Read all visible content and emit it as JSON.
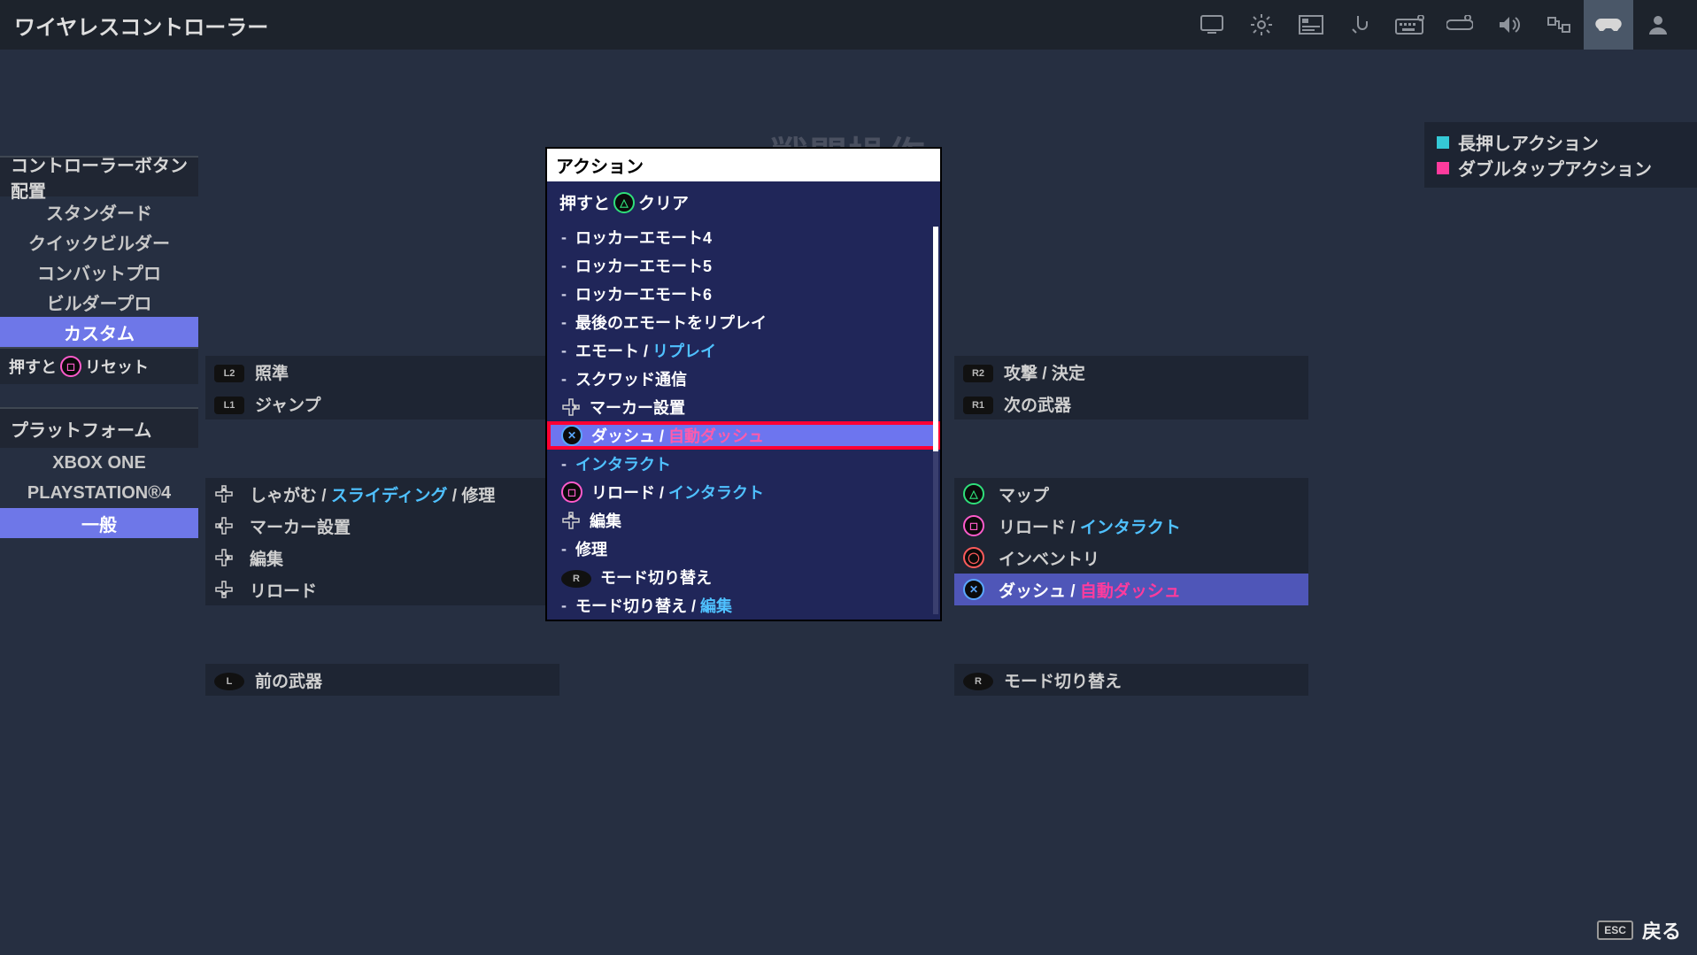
{
  "window": {
    "title": "ワイヤレスコントローラー"
  },
  "page": {
    "title": "戦闘操作"
  },
  "legend": {
    "hold": {
      "color": "#35c9d6",
      "label": "長押しアクション"
    },
    "double": {
      "color": "#ff3b9d",
      "label": "ダブルタップアクション"
    }
  },
  "sidebar": {
    "layout_header": "コントローラーボタン配置",
    "layouts": [
      {
        "label": "スタンダード"
      },
      {
        "label": "クイックビルダー"
      },
      {
        "label": "コンバットプロ"
      },
      {
        "label": "ビルダープロ"
      },
      {
        "label": "カスタム",
        "selected": true
      }
    ],
    "reset": {
      "prefix": "押すと",
      "suffix": "リセット"
    },
    "platform_header": "プラットフォーム",
    "platforms": [
      {
        "label": "XBOX ONE"
      },
      {
        "label": "PLAYSTATION®4"
      },
      {
        "label": "一般",
        "selected": true
      }
    ]
  },
  "bindings": {
    "left": [
      {
        "icon": "l2",
        "labels": [
          "照準"
        ]
      },
      {
        "icon": "l1",
        "labels": [
          "ジャンプ"
        ],
        "gapAfter": true
      },
      {
        "icon": "dpad-u",
        "labels": [
          "しゃがむ",
          " / ",
          {
            "t": "スライディング",
            "hl": true
          },
          " / ",
          "修理"
        ]
      },
      {
        "icon": "dpad-l",
        "labels": [
          "マーカー設置"
        ]
      },
      {
        "icon": "dpad-r",
        "labels": [
          "編集"
        ]
      },
      {
        "icon": "dpad-d",
        "labels": [
          "リロード"
        ],
        "gapAfter": true
      },
      {
        "icon": "ls",
        "labels": [
          "前の武器"
        ]
      }
    ],
    "right": [
      {
        "icon": "r2",
        "labels": [
          "攻撃 / 決定"
        ]
      },
      {
        "icon": "r1",
        "labels": [
          "次の武器"
        ],
        "gapAfter": true
      },
      {
        "icon": "ps-t",
        "labels": [
          "マップ"
        ]
      },
      {
        "icon": "ps-s",
        "labels": [
          "リロード / ",
          {
            "t": "インタラクト",
            "hl": true
          }
        ]
      },
      {
        "icon": "ps-o",
        "labels": [
          "インベントリ"
        ]
      },
      {
        "icon": "ps-x",
        "labels": [
          "ダッシュ / ",
          {
            "t": "自動ダッシュ",
            "dt": true
          }
        ],
        "selected": true,
        "gapAfter": true
      },
      {
        "icon": "rs",
        "labels": [
          "モード切り替え"
        ]
      }
    ]
  },
  "popup": {
    "title": "アクション",
    "subheader": {
      "prefix": "押すと",
      "suffix": "クリア"
    },
    "items": [
      {
        "icon": "-",
        "labels": [
          "ロッカーエモート4"
        ]
      },
      {
        "icon": "-",
        "labels": [
          "ロッカーエモート5"
        ]
      },
      {
        "icon": "-",
        "labels": [
          "ロッカーエモート6"
        ]
      },
      {
        "icon": "-",
        "labels": [
          "最後のエモートをリプレイ"
        ]
      },
      {
        "icon": "-",
        "labels": [
          "エモート / ",
          {
            "t": "リプレイ",
            "hl": true
          }
        ]
      },
      {
        "icon": "-",
        "labels": [
          "スクワッド通信"
        ]
      },
      {
        "icon": "dpad-r",
        "labels": [
          "マーカー設置"
        ]
      },
      {
        "icon": "ps-x",
        "labels": [
          "ダッシュ / ",
          {
            "t": "自動ダッシュ",
            "dt": true
          }
        ],
        "selected": true,
        "boxed": true
      },
      {
        "icon": "-",
        "labels": [
          {
            "t": "インタラクト",
            "hl": true
          }
        ]
      },
      {
        "icon": "ps-s",
        "labels": [
          "リロード / ",
          {
            "t": "インタラクト",
            "hl": true
          }
        ]
      },
      {
        "icon": "dpad-u",
        "labels": [
          "編集"
        ]
      },
      {
        "icon": "-",
        "labels": [
          "修理"
        ]
      },
      {
        "icon": "rs",
        "labels": [
          "モード切り替え"
        ]
      },
      {
        "icon": "-",
        "labels": [
          "モード切り替え / ",
          {
            "t": "編集",
            "hl": true
          }
        ]
      }
    ]
  },
  "footer": {
    "back": "戻る",
    "esc": "ESC"
  }
}
